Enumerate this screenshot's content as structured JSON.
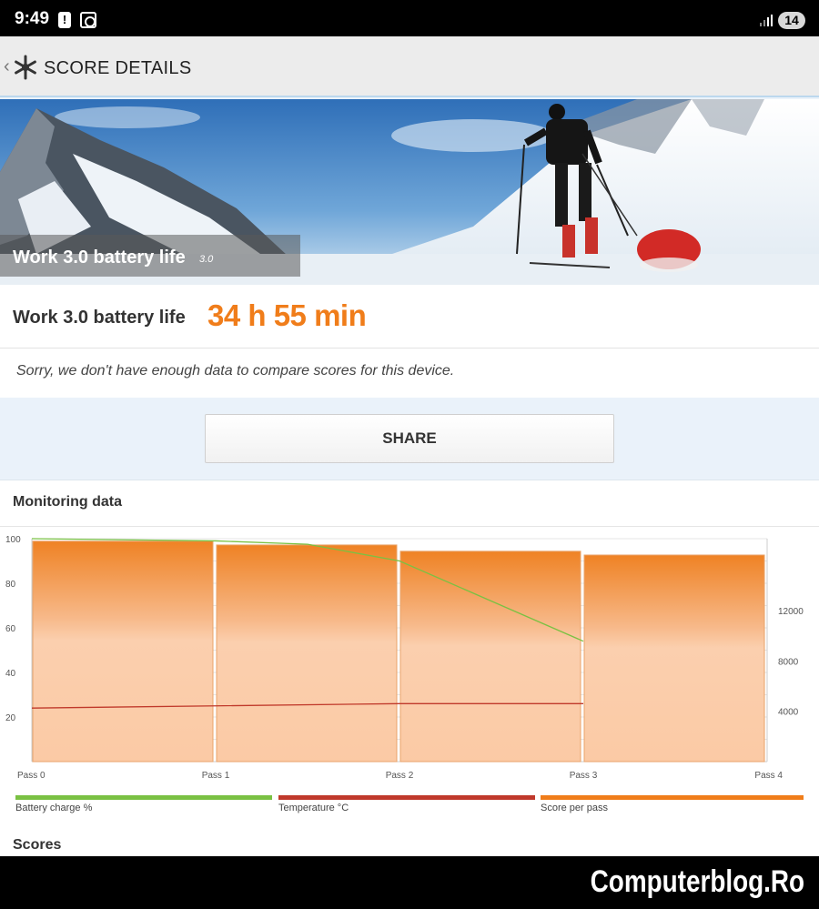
{
  "status_bar": {
    "time": "9:49",
    "battery_level": "14",
    "icons": [
      "alert-icon",
      "screenshot-icon",
      "signal-icon"
    ]
  },
  "app_bar": {
    "title": "SCORE DETAILS",
    "back_icon": "chevron-left-icon",
    "logo_icon": "snowflake-icon"
  },
  "banner": {
    "caption": "Work 3.0 battery life",
    "version": "3.0"
  },
  "score": {
    "label": "Work 3.0 battery life",
    "value": "34 h 55 min",
    "value_color": "#f07d1a"
  },
  "compare": {
    "message": "Sorry, we don't have enough data to compare scores for this device."
  },
  "share": {
    "label": "SHARE"
  },
  "monitoring": {
    "title": "Monitoring data",
    "legend": [
      {
        "label": "Battery charge %",
        "color": "#7ac143"
      },
      {
        "label": "Temperature °C",
        "color": "#c0392b"
      },
      {
        "label": "Score per pass",
        "color": "#f07d1a"
      }
    ]
  },
  "chart_data": {
    "type": "bar",
    "x_tick_labels": [
      "Pass 0",
      "Pass 1",
      "Pass 2",
      "Pass 3",
      "Pass 4"
    ],
    "y_left_ticks": [
      "20",
      "40",
      "60",
      "80",
      "100"
    ],
    "y_left_range": [
      0,
      100
    ],
    "y_right_ticks": [
      "4000",
      "8000",
      "12000"
    ],
    "y_right_range": [
      0,
      17700
    ],
    "grid": true,
    "series": [
      {
        "name": "Score per pass",
        "axis": "right",
        "segments": [
          [
            0,
            1
          ],
          [
            1,
            2
          ],
          [
            2,
            3
          ],
          [
            3,
            4
          ]
        ],
        "values": [
          17500,
          17200,
          16700,
          16400
        ]
      },
      {
        "name": "Battery charge %",
        "axis": "left",
        "x": [
          0,
          1,
          1.5,
          2,
          2.5,
          3
        ],
        "values": [
          100,
          99,
          97.5,
          90,
          72,
          54
        ]
      },
      {
        "name": "Temperature °C",
        "axis": "left",
        "x": [
          0,
          1,
          2,
          3
        ],
        "values": [
          24,
          25,
          26,
          26
        ]
      }
    ]
  },
  "scores": {
    "title": "Scores"
  },
  "watermark": {
    "text": "Computerblog.Ro"
  }
}
